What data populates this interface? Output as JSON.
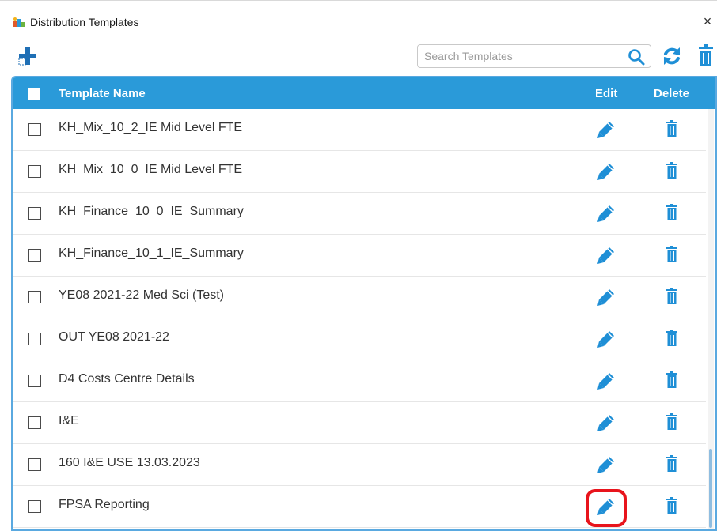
{
  "window": {
    "title": "Distribution Templates",
    "close_label": "×"
  },
  "toolbar": {
    "search_placeholder": "Search Templates",
    "search_value": ""
  },
  "grid": {
    "columns": {
      "name": "Template Name",
      "edit": "Edit",
      "delete": "Delete"
    },
    "rows": [
      {
        "name": "KH_Mix_10_2_IE Mid Level FTE"
      },
      {
        "name": "KH_Mix_10_0_IE Mid Level FTE"
      },
      {
        "name": "KH_Finance_10_0_IE_Summary"
      },
      {
        "name": "KH_Finance_10_1_IE_Summary"
      },
      {
        "name": "YE08 2021-22 Med Sci (Test)"
      },
      {
        "name": "OUT YE08 2021-22"
      },
      {
        "name": "D4 Costs Centre Details"
      },
      {
        "name": "I&E"
      },
      {
        "name": "160 I&E USE 13.03.2023"
      },
      {
        "name": "FPSA Reporting"
      }
    ],
    "highlighted_row": 9
  },
  "colors": {
    "header_bg": "#2a9ad9",
    "icon_blue": "#1f8fd6",
    "highlight": "#e8141c"
  },
  "icons": {
    "app": "distribution-chart-icon",
    "add": "add-plus-icon",
    "search": "search-icon",
    "refresh": "refresh-icon",
    "delete_all": "trash-icon",
    "edit": "pencil-icon",
    "delete": "trash-icon"
  }
}
